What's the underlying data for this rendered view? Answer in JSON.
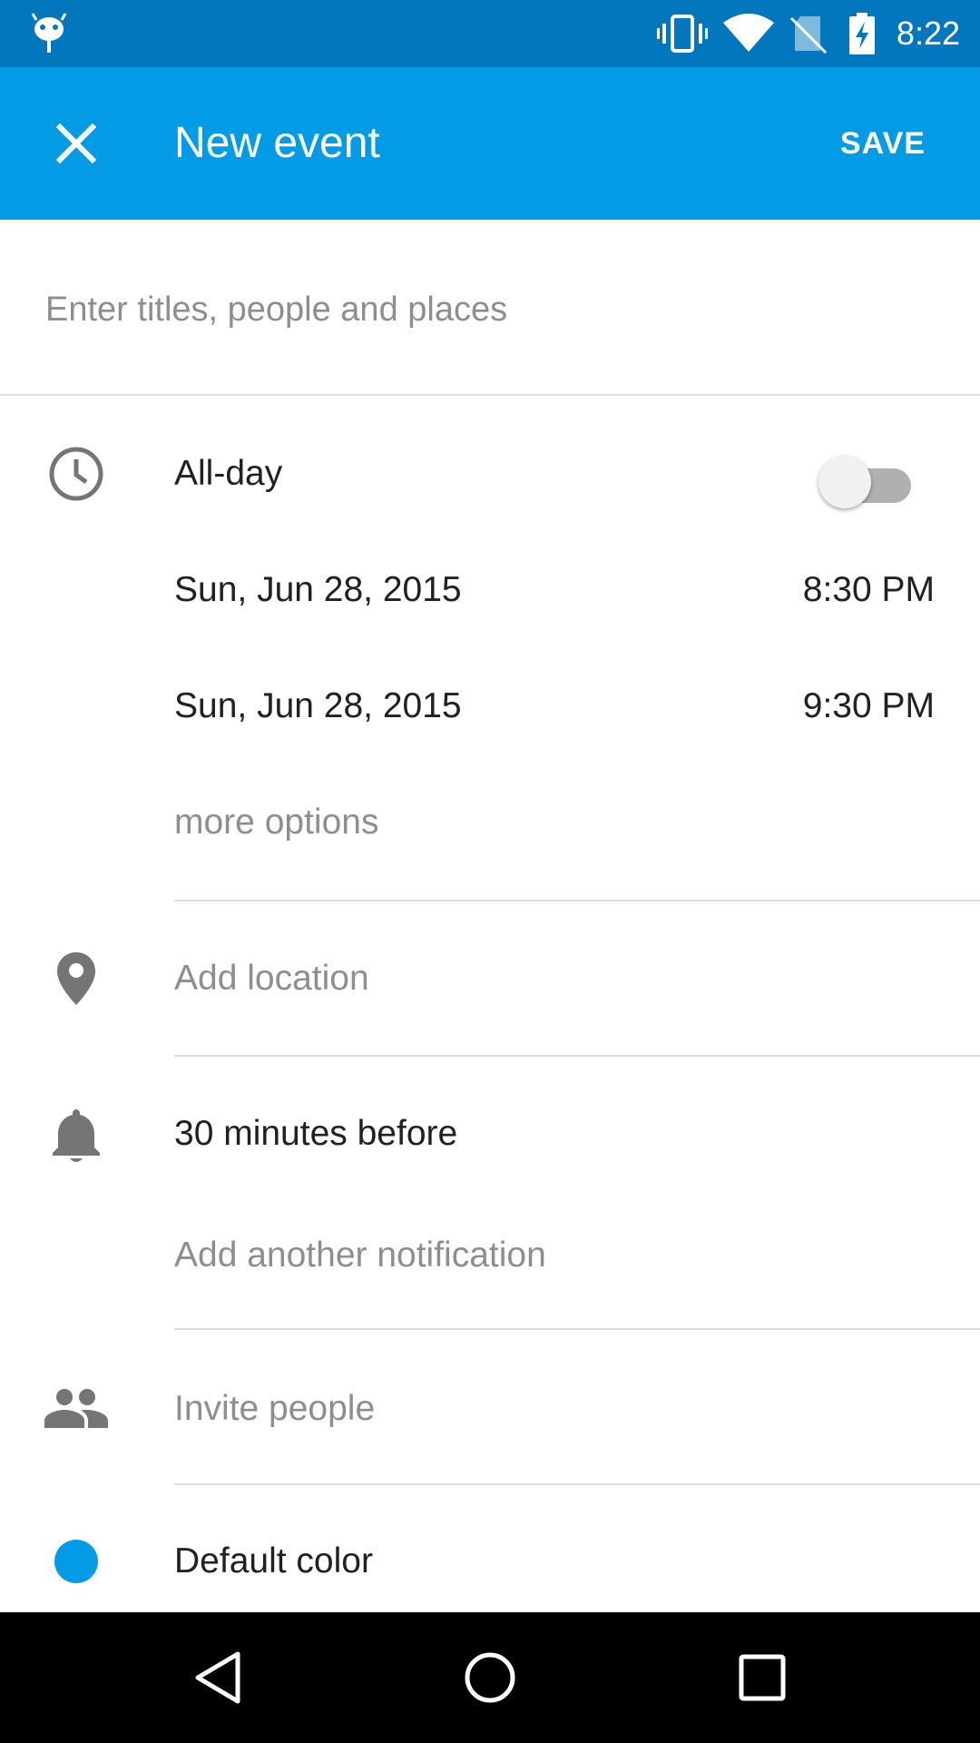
{
  "status_bar": {
    "time": "8:22",
    "icons": [
      "android-debug-icon",
      "vibrate-icon",
      "wifi-icon",
      "no-sim-icon",
      "battery-charging-icon"
    ]
  },
  "app_bar": {
    "title": "New event",
    "save_label": "SAVE",
    "close_icon": "close-icon",
    "background": "#039be5"
  },
  "title_field": {
    "placeholder": "Enter titles, people and places",
    "value": ""
  },
  "time_section": {
    "all_day_label": "All-day",
    "all_day_enabled": false,
    "start_date": "Sun, Jun 28, 2015",
    "start_time": "8:30 PM",
    "end_date": "Sun, Jun 28, 2015",
    "end_time": "9:30 PM",
    "more_options": "more options"
  },
  "location": {
    "placeholder": "Add location"
  },
  "notifications": {
    "current": "30 minutes before",
    "add_another": "Add another notification"
  },
  "people": {
    "placeholder": "Invite people"
  },
  "color": {
    "label": "Default color",
    "value": "#039be5"
  },
  "nav_bar": {
    "buttons": [
      "back-icon",
      "home-icon",
      "recents-icon"
    ]
  }
}
